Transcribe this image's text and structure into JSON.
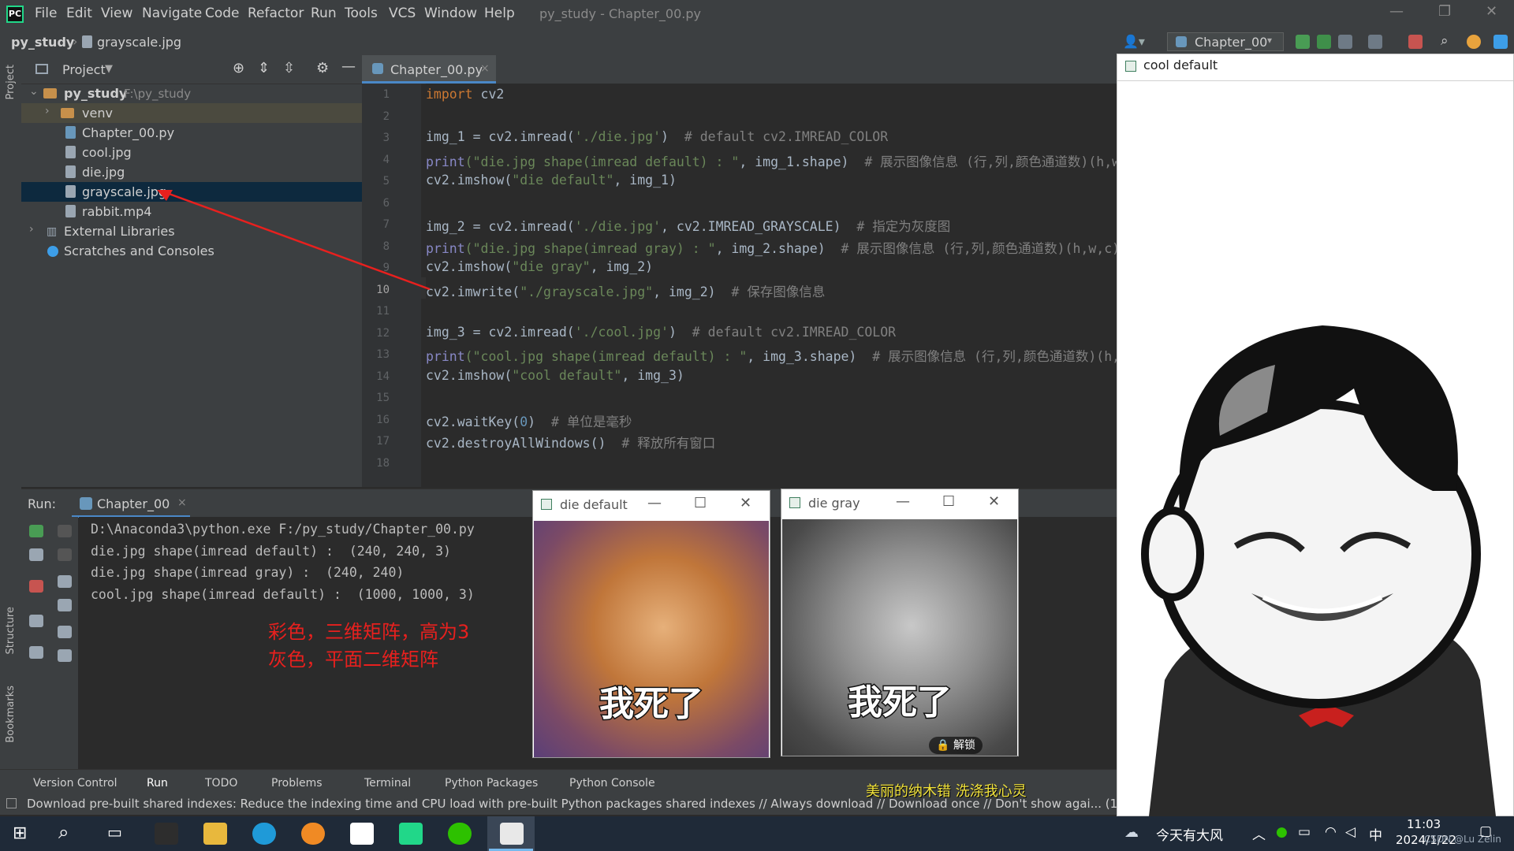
{
  "app": {
    "menu": [
      "File",
      "Edit",
      "View",
      "Navigate",
      "Code",
      "Refactor",
      "Run",
      "Tools",
      "VCS",
      "Window",
      "Help"
    ],
    "window_title": "py_study - Chapter_00.py"
  },
  "navbar": {
    "project": "py_study",
    "file": "grayscale.jpg",
    "run_config": "Chapter_00"
  },
  "project_panel": {
    "title": "Project",
    "stripe_label": "Project",
    "root": {
      "name": "py_study",
      "path": "F:\\py_study"
    },
    "items": [
      {
        "label": "venv",
        "kind": "folder"
      },
      {
        "label": "Chapter_00.py",
        "kind": "py"
      },
      {
        "label": "cool.jpg",
        "kind": "img"
      },
      {
        "label": "die.jpg",
        "kind": "img"
      },
      {
        "label": "grayscale.jpg",
        "kind": "img",
        "selected": true
      },
      {
        "label": "rabbit.mp4",
        "kind": "img"
      }
    ],
    "external": "External Libraries",
    "scratches": "Scratches and Consoles"
  },
  "editor": {
    "tab": "Chapter_00.py",
    "line_numbers": [
      "1",
      "2",
      "3",
      "4",
      "5",
      "6",
      "7",
      "8",
      "9",
      "10",
      "11",
      "12",
      "13",
      "14",
      "15",
      "16",
      "17",
      "18"
    ],
    "current_line": "10",
    "code": {
      "l1_kw": "import",
      "l1_rest": " cv2",
      "l3_a": "img_1 = cv2.imread(",
      "l3_s": "'./die.jpg'",
      "l3_b": ")  ",
      "l3_c": "# default cv2.IMREAD_COLOR",
      "l4_a": "print",
      "l4_s": "(\"die.jpg shape(imread default) : \"",
      "l4_b": ", img_1.shape)  ",
      "l4_c": "# 展示图像信息 (行,列,颜色通道数)(h,w",
      "l5_a": "cv2.imshow(",
      "l5_s": "\"die default\"",
      "l5_b": ", img_1)",
      "l7_a": "img_2 = cv2.imread(",
      "l7_s": "'./die.jpg'",
      "l7_b": ", cv2.IMREAD_GRAYSCALE)  ",
      "l7_c": "# 指定为灰度图",
      "l8_a": "print",
      "l8_s": "(\"die.jpg shape(imread gray) : \"",
      "l8_b": ", img_2.shape)  ",
      "l8_c": "# 展示图像信息 (行,列,颜色通道数)(h,w,c)",
      "l9_a": "cv2.imshow(",
      "l9_s": "\"die gray\"",
      "l9_b": ", img_2)",
      "l10_a": "cv2.imwrite(",
      "l10_s": "\"./grayscale.jpg\"",
      "l10_b": ", img_2)  ",
      "l10_c": "# 保存图像信息",
      "l12_a": "img_3 = cv2.imread(",
      "l12_s": "'./cool.jpg'",
      "l12_b": ")  ",
      "l12_c": "# default cv2.IMREAD_COLOR",
      "l13_a": "print",
      "l13_s": "(\"cool.jpg shape(imread default) : \"",
      "l13_b": ", img_3.shape)  ",
      "l13_c": "# 展示图像信息 (行,列,颜色通道数)(h,",
      "l14_a": "cv2.imshow(",
      "l14_s": "\"cool default\"",
      "l14_b": ", img_3)",
      "l16_a": "cv2.waitKey(",
      "l16_n": "0",
      "l16_b": ")  ",
      "l16_c": "# 单位是毫秒",
      "l17_a": "cv2.destroyAllWindows()  ",
      "l17_c": "# 释放所有窗口"
    }
  },
  "run_panel": {
    "label": "Run:",
    "tab": "Chapter_00",
    "output": [
      "D:\\Anaconda3\\python.exe F:/py_study/Chapter_00.py",
      "die.jpg shape(imread default) :  (240, 240, 3)",
      "die.jpg shape(imread gray) :  (240, 240)",
      "cool.jpg shape(imread default) :  (1000, 1000, 3)"
    ],
    "annotation": [
      "彩色，三维矩阵，高为3",
      "灰色，平面二维矩阵"
    ]
  },
  "side_labels": {
    "structure": "Structure",
    "bookmarks": "Bookmarks"
  },
  "tool_tabs": [
    "Version Control",
    "Run",
    "TODO",
    "Problems",
    "Terminal",
    "Python Packages",
    "Python Console"
  ],
  "status": "Download pre-built shared indexes: Reduce the indexing time and CPU load with pre-built Python packages shared indexes // Always download // Download once // Don't show agai... (12 min",
  "cv_windows": {
    "die_default": {
      "title": "die default",
      "caption": "我死了"
    },
    "die_gray": {
      "title": "die gray",
      "caption": "我死了",
      "overlay": "解锁"
    },
    "cool_default": {
      "title": "cool default"
    }
  },
  "taskbar": {
    "weather": "今天有大风",
    "ime": "中",
    "time": "11:03",
    "date": "2024/1/22",
    "watermark": "CSDN @Lu Zelin",
    "lyric": "美丽的纳木错 洗涤我心灵"
  },
  "colors": {
    "accent": "#4a88c7",
    "annotation": "#e8201e",
    "ide_bg": "#2b2b2b"
  }
}
